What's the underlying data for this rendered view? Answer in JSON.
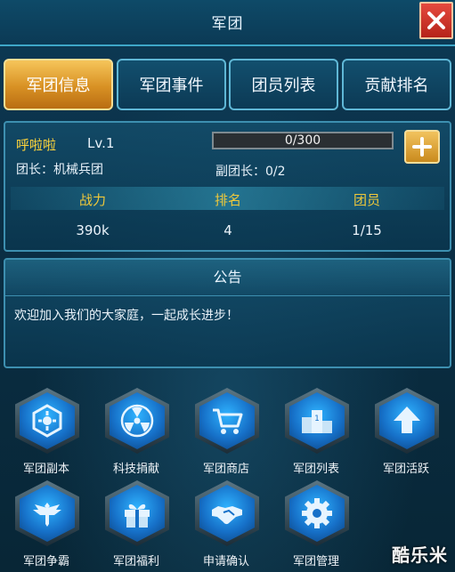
{
  "window": {
    "title": "军团"
  },
  "tabs": [
    {
      "label": "军团信息",
      "active": true
    },
    {
      "label": "军团事件",
      "active": false
    },
    {
      "label": "团员列表",
      "active": false
    },
    {
      "label": "贡献排名",
      "active": false
    }
  ],
  "info": {
    "guild_name": "呼啦啦",
    "level": "Lv.1",
    "leader": "团长：机械兵团",
    "vice_leader": "副团长：0/2",
    "progress_text": "0/300",
    "progress_value": 0,
    "stats": [
      {
        "label": "战力",
        "value": "390k"
      },
      {
        "label": "排名",
        "value": "4"
      },
      {
        "label": "团员",
        "value": "1/15"
      }
    ]
  },
  "notice": {
    "title": "公告",
    "text": "欢迎加入我们的大家庭，一起成长进步！"
  },
  "buttons": [
    {
      "label": "军团副本",
      "icon": "dungeon-icon"
    },
    {
      "label": "科技捐献",
      "icon": "radiation-icon"
    },
    {
      "label": "军团商店",
      "icon": "cart-icon"
    },
    {
      "label": "军团列表",
      "icon": "podium-icon"
    },
    {
      "label": "军团活跃",
      "icon": "arrow-up-icon"
    },
    {
      "label": "军团争霸",
      "icon": "eagle-icon"
    },
    {
      "label": "军团福利",
      "icon": "gift-icon"
    },
    {
      "label": "申请确认",
      "icon": "handshake-icon"
    },
    {
      "label": "军团管理",
      "icon": "gear-icon"
    }
  ],
  "watermark": "酷乐米",
  "colors": {
    "accent_gold": "#f0c93a",
    "tab_active": "#d89124",
    "close_red": "#c8342a"
  }
}
